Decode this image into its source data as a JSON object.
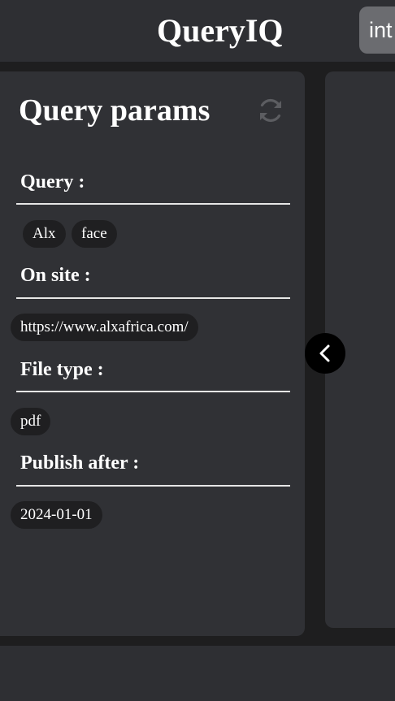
{
  "header": {
    "app_title": "QueryIQ",
    "lang_button_label": "int"
  },
  "params_panel": {
    "title": "Query params",
    "refresh_icon": "refresh-icon",
    "sections": {
      "query": {
        "label": "Query :",
        "chips": [
          "Alx",
          "face"
        ]
      },
      "on_site": {
        "label": "On site :",
        "chips": [
          "https://www.alxafrica.com/"
        ]
      },
      "file_type": {
        "label": "File type :",
        "chips": [
          "pdf"
        ]
      },
      "publish_after": {
        "label": "Publish after :",
        "chips": [
          "2024-01-01"
        ]
      }
    }
  },
  "collapse_button": {
    "icon": "chevron-left-icon"
  },
  "colors": {
    "background": "#1e1e1f",
    "panel": "#303135",
    "chip": "#1f1f21",
    "lang_button": "#6b6c70",
    "collapse_button": "#000000"
  }
}
